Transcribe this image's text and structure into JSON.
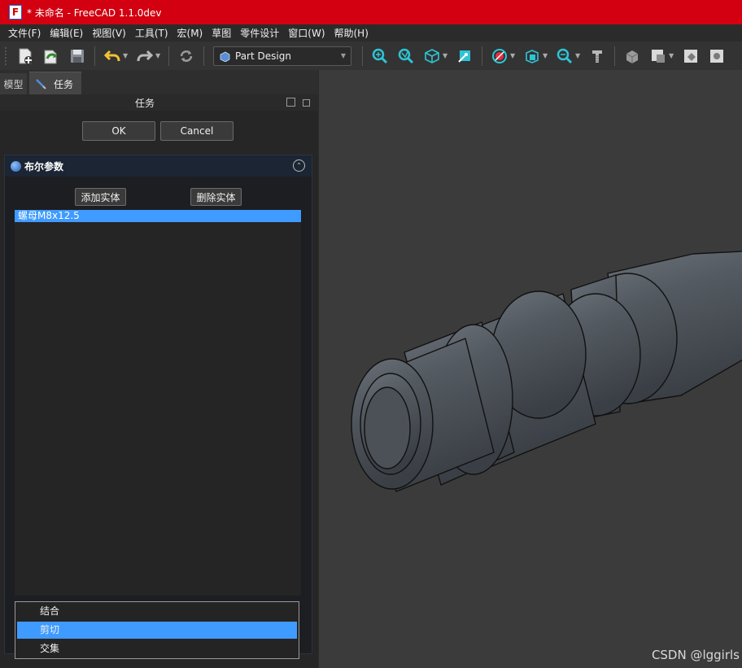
{
  "window": {
    "title": "* 未命名 - FreeCAD 1.1.0dev",
    "app_icon": "freecad-icon"
  },
  "menubar": [
    "文件(F)",
    "编辑(E)",
    "视图(V)",
    "工具(T)",
    "宏(M)",
    "草图",
    "零件设计",
    "窗口(W)",
    "帮助(H)"
  ],
  "toolbar": {
    "workbench": "Part Design",
    "icons": [
      "new-document-icon",
      "open-document-icon",
      "save-icon",
      "undo-icon",
      "redo-icon",
      "refresh-icon",
      "fit-all-icon",
      "fit-selection-icon",
      "isometric-view-icon",
      "measure-icon",
      "draw-style-icon",
      "view-box-icon",
      "zoom-icon",
      "thread-tool-icon",
      "part-icon",
      "create-body-icon",
      "link-icon"
    ]
  },
  "left_panel": {
    "tabs": [
      "模型",
      "任务"
    ],
    "panel_title": "任务",
    "ok_label": "OK",
    "cancel_label": "Cancel",
    "boolean": {
      "header": "布尔参数",
      "add_body_label": "添加实体",
      "remove_body_label": "删除实体",
      "bodies": [
        "螺母M8x12.5"
      ]
    },
    "operation_dropdown": {
      "options": [
        "结合",
        "剪切",
        "交集"
      ],
      "selected": "剪切"
    }
  },
  "viewport": {
    "watermark": "CSDN @lggirls",
    "model_color": "#4a5057"
  },
  "colors": {
    "titlebar": "#d20010",
    "selection": "#3f9bff"
  }
}
